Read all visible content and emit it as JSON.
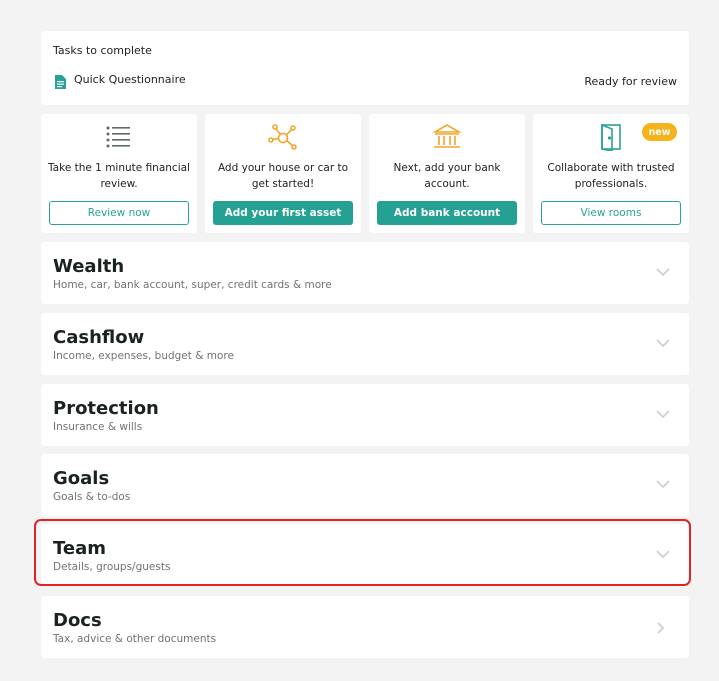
{
  "tasks": {
    "title": "Tasks to complete",
    "items": [
      {
        "name": "Quick Questionnaire",
        "status": "Ready for review",
        "icon": "document-icon"
      }
    ]
  },
  "cards": [
    {
      "icon": "list-icon",
      "text": "Take the 1 minute financial review.",
      "button": "Review now",
      "button_style": "outline"
    },
    {
      "icon": "network-icon",
      "text": "Add your house or car to get started!",
      "button": "Add your first asset",
      "button_style": "solid"
    },
    {
      "icon": "bank-icon",
      "text": "Next, add your bank account.",
      "button": "Add bank account",
      "button_style": "solid"
    },
    {
      "icon": "door-icon",
      "text": "Collaborate with trusted professionals.",
      "button": "View rooms",
      "button_style": "outline",
      "badge": "new"
    }
  ],
  "sections": [
    {
      "title": "Wealth",
      "subtitle": "Home, car, bank account, super, credit cards & more",
      "chevron": "chevron-down-icon"
    },
    {
      "title": "Cashflow",
      "subtitle": "Income, expenses, budget & more",
      "chevron": "chevron-down-icon"
    },
    {
      "title": "Protection",
      "subtitle": "Insurance & wills",
      "chevron": "chevron-down-icon"
    },
    {
      "title": "Goals",
      "subtitle": "Goals & to-dos",
      "chevron": "chevron-down-icon"
    },
    {
      "title": "Team",
      "subtitle": "Details, groups/guests",
      "chevron": "chevron-down-icon",
      "highlighted": true
    },
    {
      "title": "Docs",
      "subtitle": "Tax, advice & other documents",
      "chevron": "chevron-right-icon"
    }
  ],
  "colors": {
    "accent": "#24a193",
    "accent_outline": "#2aa198",
    "icon_orange": "#f2a52b",
    "badge": "#f6b21b",
    "highlight": "#e02424",
    "background": "#f3f3f3"
  }
}
